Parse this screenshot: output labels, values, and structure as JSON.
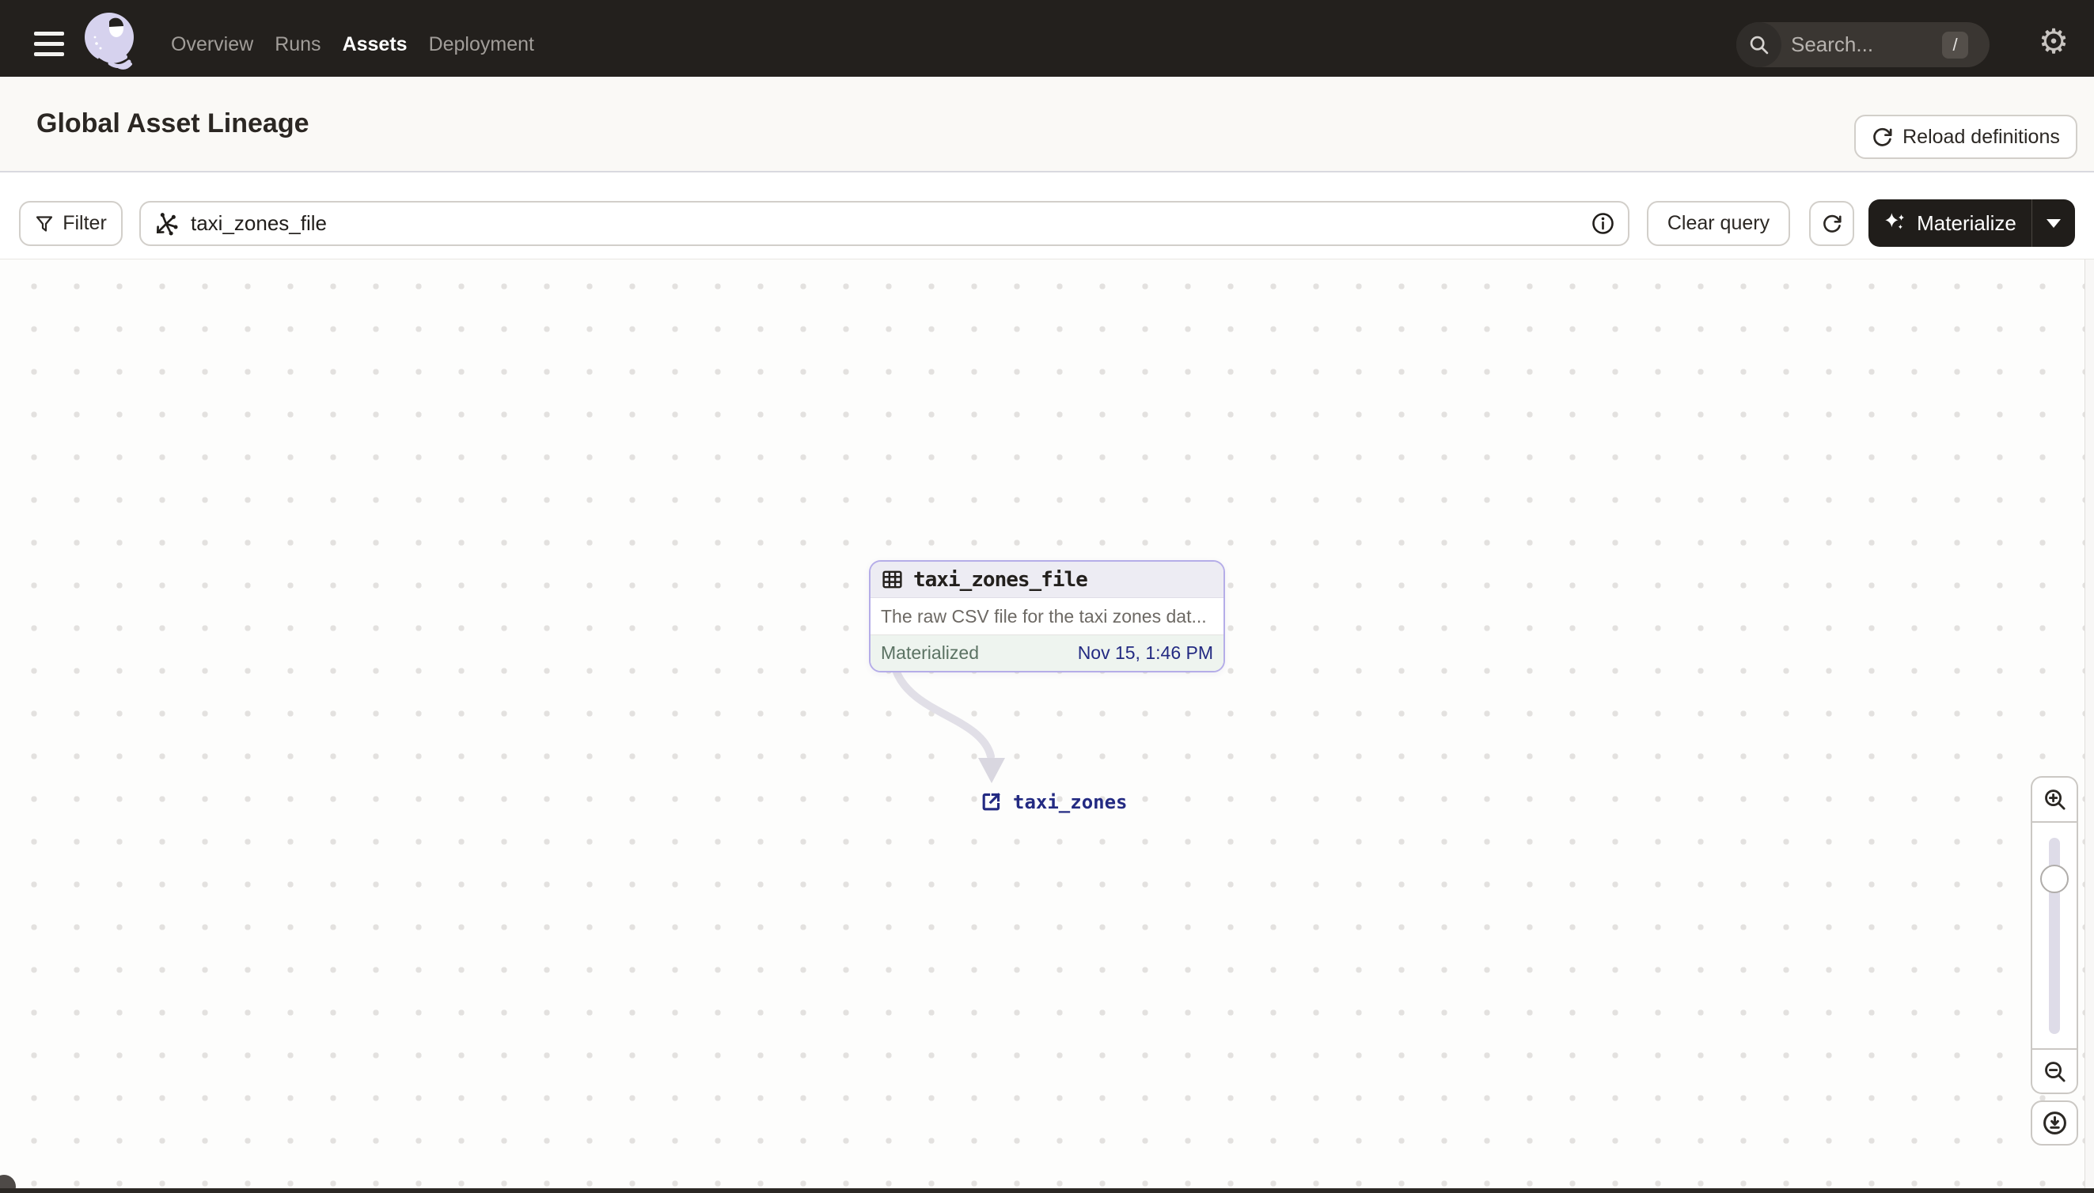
{
  "navbar": {
    "items": [
      {
        "label": "Overview"
      },
      {
        "label": "Runs"
      },
      {
        "label": "Assets"
      },
      {
        "label": "Deployment"
      }
    ],
    "active_item": "Assets",
    "search": {
      "placeholder": "Search...",
      "shortcut": "/"
    }
  },
  "header": {
    "title": "Global Asset Lineage",
    "reload_button": "Reload definitions"
  },
  "toolbar": {
    "filter_button": "Filter",
    "query_value": "taxi_zones_file",
    "clear_button": "Clear query",
    "materialize_button": "Materialize"
  },
  "graph": {
    "node": {
      "name": "taxi_zones_file",
      "description": "The raw CSV file for the taxi zones dat...",
      "status": "Materialized",
      "materialized_at": "Nov 15, 1:46 PM"
    },
    "downstream_asset": {
      "name": "taxi_zones"
    },
    "edge": {
      "from": "taxi_zones_file",
      "to": "taxi_zones"
    }
  },
  "colors": {
    "navbar_bg": "#23201d",
    "accent_lavender": "#b5ade8",
    "link_navy": "#232a82",
    "materialized_bg": "#eef4ef",
    "materialized_text": "#5b7263",
    "dark_button_bg": "#201d1a",
    "page_header_bg": "#faf9f6"
  },
  "icons": {
    "gear": "⚙"
  }
}
